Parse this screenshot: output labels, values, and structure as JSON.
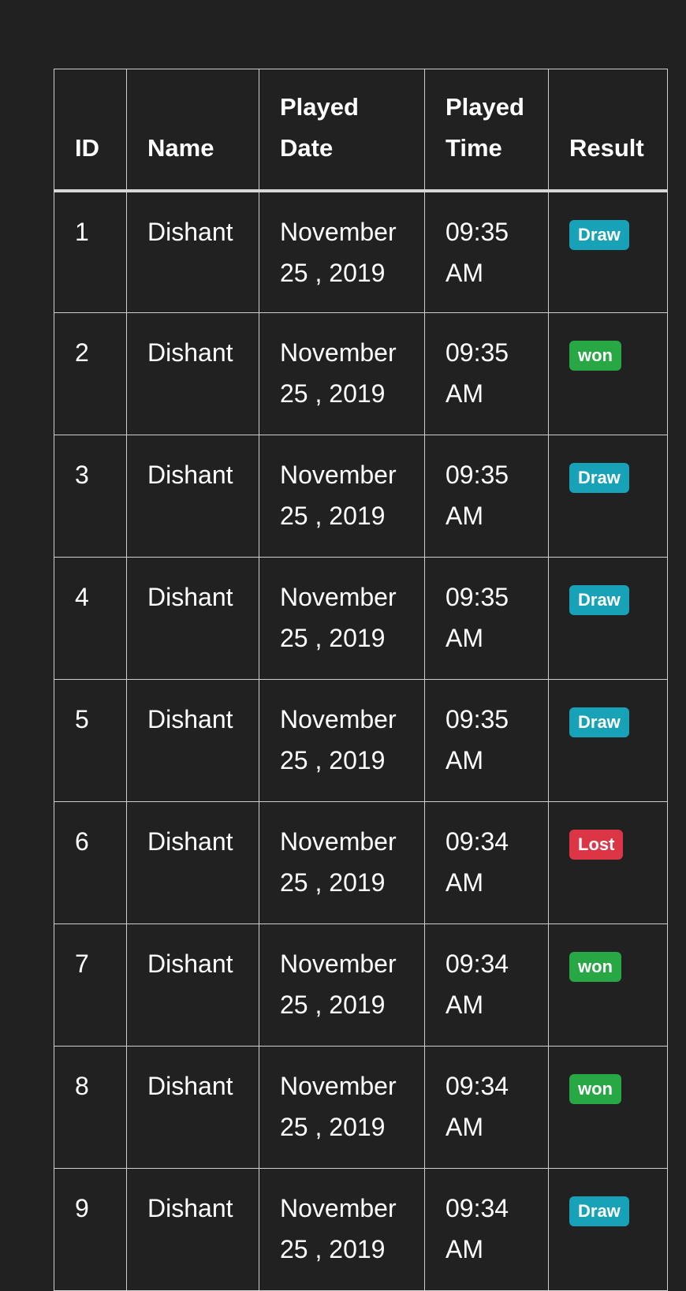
{
  "colors": {
    "background": "#212121",
    "border": "#cfcfcf",
    "draw": "#17a2b8",
    "won": "#28a745",
    "lost": "#dc3545"
  },
  "table": {
    "headers": {
      "id": "ID",
      "name": "Name",
      "played_date": "Played Date",
      "played_time": "Played Time",
      "result": "Result"
    },
    "rows": [
      {
        "id": "1",
        "name": "Dishant",
        "date": "November 25 , 2019",
        "time": "09:35 AM",
        "result": "Draw",
        "status": "draw"
      },
      {
        "id": "2",
        "name": "Dishant",
        "date": "November 25 , 2019",
        "time": "09:35 AM",
        "result": "won",
        "status": "won"
      },
      {
        "id": "3",
        "name": "Dishant",
        "date": "November 25 , 2019",
        "time": "09:35 AM",
        "result": "Draw",
        "status": "draw"
      },
      {
        "id": "4",
        "name": "Dishant",
        "date": "November 25 , 2019",
        "time": "09:35 AM",
        "result": "Draw",
        "status": "draw"
      },
      {
        "id": "5",
        "name": "Dishant",
        "date": "November 25 , 2019",
        "time": "09:35 AM",
        "result": "Draw",
        "status": "draw"
      },
      {
        "id": "6",
        "name": "Dishant",
        "date": "November 25 , 2019",
        "time": "09:34 AM",
        "result": "Lost",
        "status": "lost"
      },
      {
        "id": "7",
        "name": "Dishant",
        "date": "November 25 , 2019",
        "time": "09:34 AM",
        "result": "won",
        "status": "won"
      },
      {
        "id": "8",
        "name": "Dishant",
        "date": "November 25 , 2019",
        "time": "09:34 AM",
        "result": "won",
        "status": "won"
      },
      {
        "id": "9",
        "name": "Dishant",
        "date": "November 25 , 2019",
        "time": "09:34 AM",
        "result": "Draw",
        "status": "draw"
      }
    ]
  }
}
